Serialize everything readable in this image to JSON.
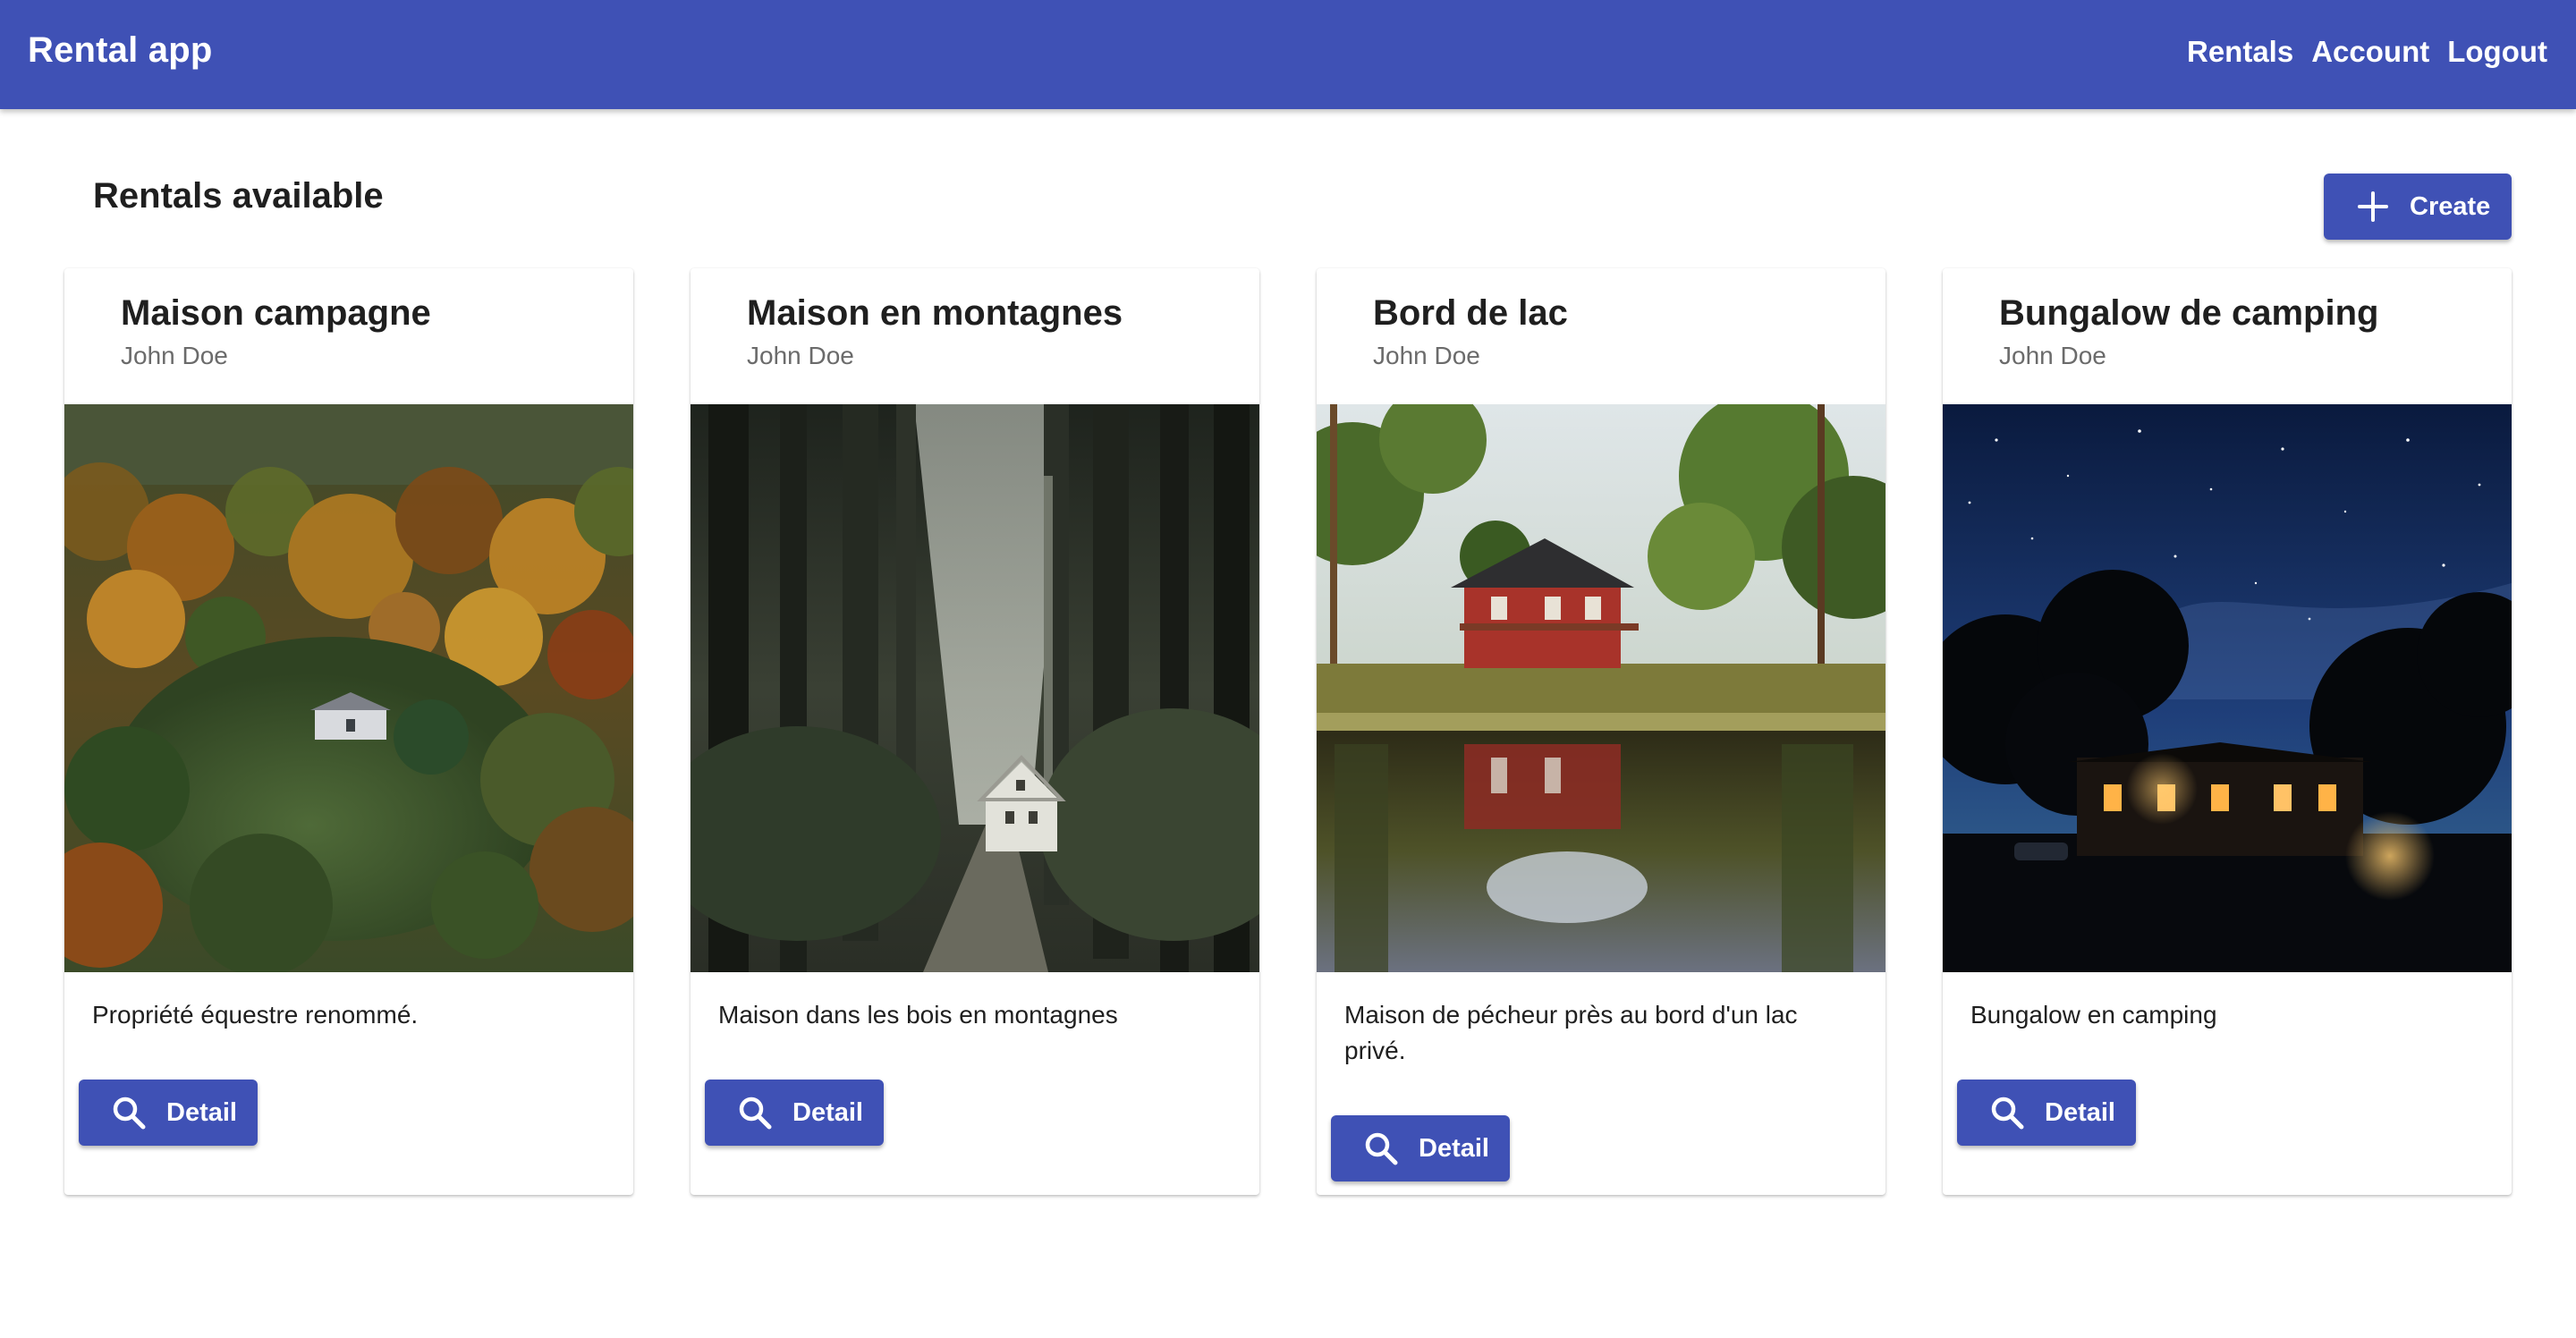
{
  "header": {
    "app_title": "Rental app",
    "nav": [
      "Rentals",
      "Account",
      "Logout"
    ]
  },
  "main": {
    "title": "Rentals available",
    "create_label": "Create"
  },
  "rentals": [
    {
      "title": "Maison campagne",
      "owner": "John Doe",
      "description": "Propriété équestre renommé.",
      "detail_label": "Detail",
      "image": "aerial-autumn-forest-farmhouse"
    },
    {
      "title": "Maison en montagnes",
      "owner": "John Doe",
      "description": "Maison dans les bois en montagnes",
      "detail_label": "Detail",
      "image": "house-in-dark-forest"
    },
    {
      "title": "Bord de lac",
      "owner": "John Doe",
      "description": "Maison de pécheur près au bord d'un lac privé.",
      "detail_label": "Detail",
      "image": "red-cabin-by-lake"
    },
    {
      "title": "Bungalow de camping",
      "owner": "John Doe",
      "description": "Bungalow en camping",
      "detail_label": "Detail",
      "image": "bungalow-under-starry-sky"
    }
  ],
  "colors": {
    "primary": "#3f51b5",
    "text": "#1f1f1f",
    "subtitle": "#6b6b6b"
  }
}
